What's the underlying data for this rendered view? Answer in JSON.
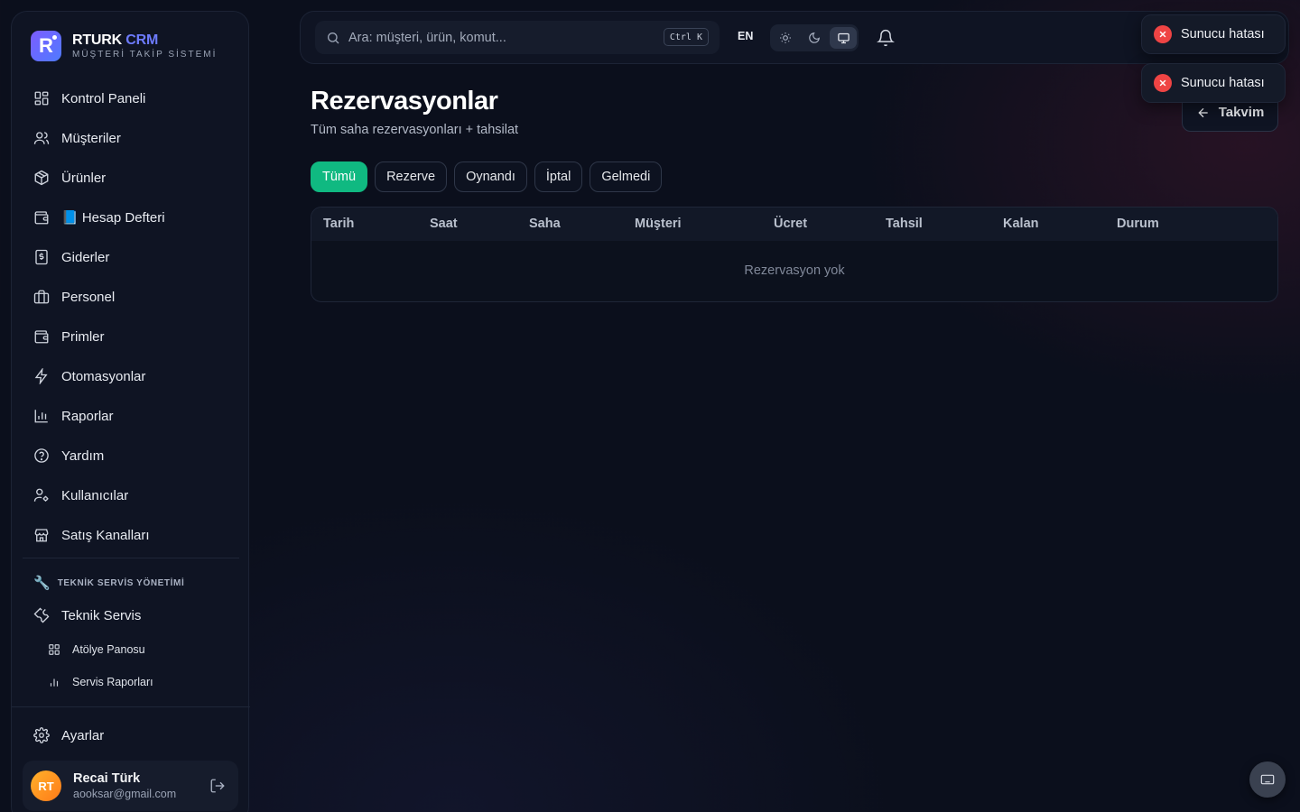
{
  "brand": {
    "name": "RTURK",
    "name_accent": "CRM",
    "subtitle": "MÜŞTERİ TAKİP SİSTEMİ",
    "logo_letter": "R"
  },
  "sidebar": {
    "items": [
      {
        "label": "Kontrol Paneli",
        "icon": "grid-icon"
      },
      {
        "label": "Müşteriler",
        "icon": "users-icon"
      },
      {
        "label": "Ürünler",
        "icon": "package-icon"
      },
      {
        "label": "📘 Hesap Defteri",
        "icon": "wallet-icon"
      },
      {
        "label": "Giderler",
        "icon": "receipt-icon"
      },
      {
        "label": "Personel",
        "icon": "briefcase-icon"
      },
      {
        "label": "Primler",
        "icon": "wallet-icon"
      },
      {
        "label": "Otomasyonlar",
        "icon": "lightning-icon"
      },
      {
        "label": "Raporlar",
        "icon": "bar-chart-icon"
      },
      {
        "label": "Yardım",
        "icon": "help-circle-icon"
      },
      {
        "label": "Kullanıcılar",
        "icon": "user-cog-icon"
      },
      {
        "label": "Satış Kanalları",
        "icon": "store-icon"
      }
    ],
    "section": {
      "emoji": "🔧",
      "title": "TEKNİK SERVİS YÖNETİMİ",
      "main_item": "Teknik Servis",
      "sub_items": [
        "Atölye Panosu",
        "Servis Raporları"
      ]
    },
    "settings_label": "Ayarlar",
    "user": {
      "initials": "RT",
      "name": "Recai Türk",
      "email": "aooksar@gmail.com"
    }
  },
  "topbar": {
    "search_placeholder": "Ara: müşteri, ürün, komut...",
    "search_shortcut": "Ctrl K",
    "language": "EN",
    "theme_options": [
      "light",
      "dark",
      "system"
    ],
    "theme_selected": "system"
  },
  "toasts": [
    "Sunucu hatası",
    "Sunucu hatası"
  ],
  "page": {
    "title": "Rezervasyonlar",
    "subtitle": "Tüm saha rezervasyonları + tahsilat",
    "back_button": "Takvim",
    "filters": [
      "Tümü",
      "Rezerve",
      "Oynandı",
      "İptal",
      "Gelmedi"
    ],
    "active_filter": "Tümü"
  },
  "table": {
    "columns": [
      "Tarih",
      "Saat",
      "Saha",
      "Müşteri",
      "Ücret",
      "Tahsil",
      "Kalan",
      "Durum"
    ],
    "rows": [],
    "empty_text": "Rezervasyon yok"
  },
  "colors": {
    "accent_green": "#10b981",
    "brand_blue": "#6d7bff",
    "error_red": "#ef4444",
    "avatar_orange": "#ff9a22"
  }
}
